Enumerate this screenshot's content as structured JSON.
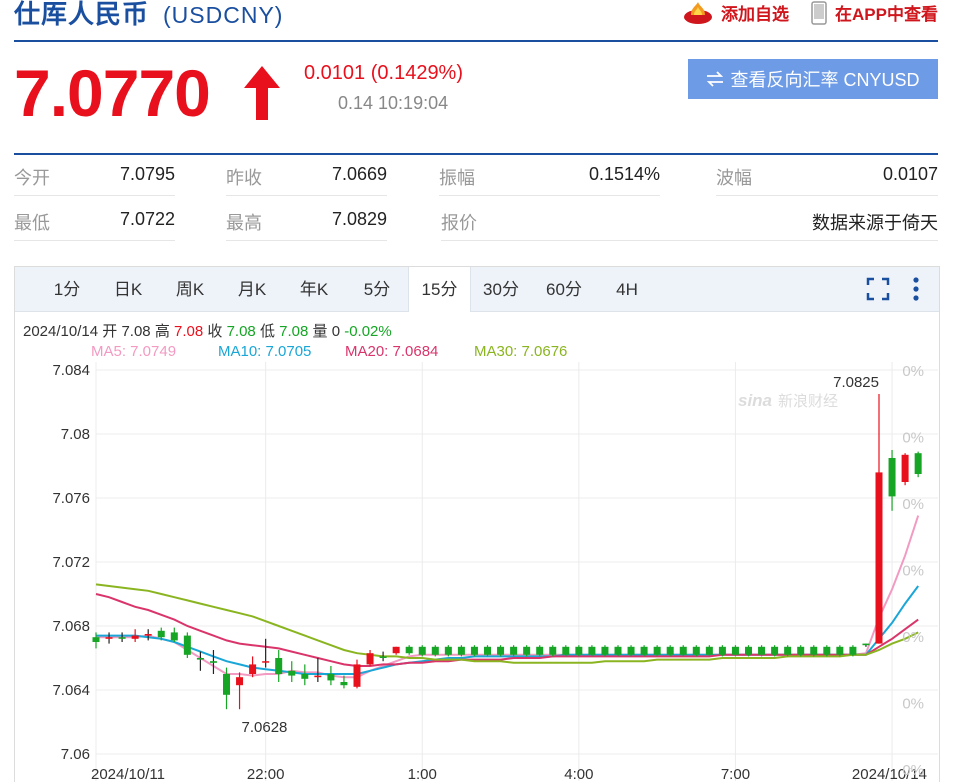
{
  "header": {
    "title": "仕厍人民币",
    "code": "(USDCNY)",
    "add_watch": "添加自选",
    "view_app": "在APP中查看"
  },
  "quote": {
    "price": "7.0770",
    "change": "0.0101 (0.1429%)",
    "time": "0.14 10:19:04",
    "reverse_button": "查看反向汇率 CNYUSD"
  },
  "stats": [
    {
      "label": "今开",
      "value": "7.0795"
    },
    {
      "label": "昨收",
      "value": "7.0669"
    },
    {
      "label": "振幅",
      "value": "0.1514%"
    },
    {
      "label": "波幅",
      "value": "0.0107"
    },
    {
      "label": "最低",
      "value": "7.0722"
    },
    {
      "label": "最高",
      "value": "7.0829"
    },
    {
      "label": "报价",
      "value": ""
    },
    {
      "label": "",
      "value": "数据来源于倚天"
    }
  ],
  "tabs": [
    "1分",
    "日K",
    "周K",
    "月K",
    "年K",
    "5分",
    "15分",
    "30分",
    "60分",
    "4H"
  ],
  "active_tab": "15分",
  "ohlc": {
    "date": "2024/10/14",
    "open_label": "开",
    "open": "7.08",
    "high_label": "高",
    "high": "7.08",
    "close_label": "收",
    "close": "7.08",
    "low_label": "低",
    "low": "7.08",
    "volume_label": "量",
    "volume": "0",
    "pct": "-0.02%"
  },
  "ma_legend": [
    {
      "text": "MA5: 7.0749",
      "color": "#f29ac2"
    },
    {
      "text": "MA10: 7.0705",
      "color": "#1aa6d6"
    },
    {
      "text": "MA20: 7.0684",
      "color": "#d9356b"
    },
    {
      "text": "MA30: 7.0676",
      "color": "#8ab520"
    }
  ],
  "colors": {
    "up": "#e8101c",
    "down": "#16a525",
    "accent": "#1a4fa0",
    "button": "#6e9be6"
  },
  "icons": [
    "flame-icon",
    "phone-icon",
    "up-arrow-icon",
    "swap-icon",
    "fullscreen-icon",
    "more-vertical-icon"
  ],
  "chart_data": {
    "type": "candlestick",
    "y_ticks": [
      "7.084",
      "7.08",
      "7.076",
      "7.072",
      "7.068",
      "7.064",
      "7.06"
    ],
    "ylim": [
      7.06,
      7.0845
    ],
    "x_ticks": [
      {
        "label": "2024/10/11",
        "index": 0
      },
      {
        "label": "22:00",
        "index": 13
      },
      {
        "label": "1:00",
        "index": 25
      },
      {
        "label": "4:00",
        "index": 37
      },
      {
        "label": "7:00",
        "index": 49
      },
      {
        "label": "2024/10/14",
        "index": 61
      }
    ],
    "right_pct_labels": [
      "0%",
      "0%",
      "0%",
      "0%",
      "0%",
      "0%",
      "0%"
    ],
    "annotations": [
      {
        "text": "7.0825",
        "index": 60,
        "value": 7.0825,
        "position": "above"
      },
      {
        "text": "7.0628",
        "index": 10,
        "value": 7.0628,
        "position": "below"
      }
    ],
    "candles": [
      [
        7.0673,
        7.067,
        7.0676,
        7.0666
      ],
      [
        7.0672,
        7.0673,
        7.0676,
        7.0669
      ],
      [
        7.0673,
        7.0672,
        7.0676,
        7.067
      ],
      [
        7.0672,
        7.0674,
        7.0678,
        7.067
      ],
      [
        7.0674,
        7.0675,
        7.0678,
        7.0671
      ],
      [
        7.0677,
        7.0673,
        7.0679,
        7.0671
      ],
      [
        7.0676,
        7.0671,
        7.0679,
        7.067
      ],
      [
        7.0674,
        7.0662,
        7.0676,
        7.066
      ],
      [
        7.066,
        7.0659,
        7.0664,
        7.0652
      ],
      [
        7.0658,
        7.0657,
        7.0665,
        7.065
      ],
      [
        7.065,
        7.0637,
        7.0654,
        7.0628
      ],
      [
        7.0643,
        7.0648,
        7.0651,
        7.0628
      ],
      [
        7.065,
        7.0656,
        7.0661,
        7.0648
      ],
      [
        7.0658,
        7.0658,
        7.0672,
        7.0654
      ],
      [
        7.066,
        7.065,
        7.0665,
        7.0645
      ],
      [
        7.0652,
        7.0649,
        7.0658,
        7.0645
      ],
      [
        7.065,
        7.0647,
        7.0656,
        7.0643
      ],
      [
        7.0648,
        7.0649,
        7.066,
        7.0645
      ],
      [
        7.065,
        7.0646,
        7.0655,
        7.0643
      ],
      [
        7.0645,
        7.0643,
        7.0649,
        7.0641
      ],
      [
        7.0642,
        7.0656,
        7.0659,
        7.0641
      ],
      [
        7.0656,
        7.0663,
        7.0665,
        7.0655
      ],
      [
        7.0661,
        7.066,
        7.0664,
        7.0658
      ],
      [
        7.0663,
        7.0667,
        7.0667,
        7.0662
      ],
      [
        7.0667,
        7.0663,
        7.0668,
        7.0662
      ],
      [
        7.0667,
        7.0662,
        7.0668,
        7.0661
      ],
      [
        7.0667,
        7.0662,
        7.0668,
        7.0661
      ],
      [
        7.0667,
        7.0662,
        7.0668,
        7.0661
      ],
      [
        7.0667,
        7.0662,
        7.0668,
        7.0661
      ],
      [
        7.0667,
        7.0662,
        7.0668,
        7.0661
      ],
      [
        7.0667,
        7.0662,
        7.0668,
        7.0661
      ],
      [
        7.0667,
        7.0662,
        7.0668,
        7.0661
      ],
      [
        7.0667,
        7.0662,
        7.0668,
        7.0661
      ],
      [
        7.0667,
        7.0662,
        7.0668,
        7.0661
      ],
      [
        7.0667,
        7.0662,
        7.0668,
        7.0661
      ],
      [
        7.0667,
        7.0662,
        7.0668,
        7.0661
      ],
      [
        7.0667,
        7.0662,
        7.0668,
        7.0661
      ],
      [
        7.0667,
        7.0662,
        7.0668,
        7.0661
      ],
      [
        7.0667,
        7.0662,
        7.0668,
        7.0661
      ],
      [
        7.0667,
        7.0662,
        7.0668,
        7.0661
      ],
      [
        7.0667,
        7.0662,
        7.0668,
        7.0661
      ],
      [
        7.0667,
        7.0662,
        7.0668,
        7.0661
      ],
      [
        7.0667,
        7.0662,
        7.0668,
        7.0661
      ],
      [
        7.0667,
        7.0662,
        7.0668,
        7.0661
      ],
      [
        7.0667,
        7.0662,
        7.0668,
        7.0661
      ],
      [
        7.0667,
        7.0662,
        7.0668,
        7.0661
      ],
      [
        7.0667,
        7.0662,
        7.0668,
        7.0661
      ],
      [
        7.0667,
        7.0662,
        7.0668,
        7.0661
      ],
      [
        7.0667,
        7.0662,
        7.0668,
        7.0661
      ],
      [
        7.0667,
        7.0662,
        7.0668,
        7.0661
      ],
      [
        7.0667,
        7.0662,
        7.0668,
        7.0661
      ],
      [
        7.0667,
        7.0662,
        7.0668,
        7.0661
      ],
      [
        7.0667,
        7.0662,
        7.0668,
        7.0661
      ],
      [
        7.0667,
        7.0662,
        7.0668,
        7.0661
      ],
      [
        7.0667,
        7.0662,
        7.0668,
        7.0661
      ],
      [
        7.0667,
        7.0662,
        7.0668,
        7.0661
      ],
      [
        7.0667,
        7.0662,
        7.0668,
        7.0661
      ],
      [
        7.0667,
        7.0662,
        7.0668,
        7.0661
      ],
      [
        7.0667,
        7.0662,
        7.0668,
        7.0661
      ],
      [
        7.0669,
        7.0668,
        7.0669,
        7.0667
      ],
      [
        7.0669,
        7.0776,
        7.0825,
        7.0669
      ],
      [
        7.0785,
        7.0761,
        7.079,
        7.0752
      ],
      [
        7.077,
        7.0787,
        7.0788,
        7.0768
      ],
      [
        7.0788,
        7.0775,
        7.0789,
        7.0773
      ]
    ],
    "ma": {
      "MA5": [
        7.0673,
        7.0673,
        7.0673,
        7.0673,
        7.0674,
        7.0672,
        7.067,
        7.0665,
        7.066,
        7.0655,
        7.065,
        7.065,
        7.0649,
        7.065,
        7.065,
        7.0652,
        7.0651,
        7.0651,
        7.0649,
        7.0648,
        7.0648,
        7.0652,
        7.0655,
        7.0658,
        7.0661,
        7.0662,
        7.0662,
        7.0662,
        7.0662,
        7.0662,
        7.0662,
        7.0662,
        7.0662,
        7.0662,
        7.0662,
        7.0662,
        7.0662,
        7.0662,
        7.0662,
        7.0662,
        7.0662,
        7.0662,
        7.0662,
        7.0662,
        7.0662,
        7.0662,
        7.0662,
        7.0662,
        7.0662,
        7.0662,
        7.0662,
        7.0662,
        7.0662,
        7.0662,
        7.0662,
        7.0662,
        7.0662,
        7.0662,
        7.0662,
        7.0663,
        7.0685,
        7.0703,
        7.0724,
        7.0749
      ],
      "MA10": [
        7.0674,
        7.0674,
        7.0674,
        7.0674,
        7.0673,
        7.0672,
        7.067,
        7.0667,
        7.0664,
        7.0661,
        7.0658,
        7.0656,
        7.0654,
        7.0653,
        7.0652,
        7.0651,
        7.065,
        7.065,
        7.065,
        7.065,
        7.065,
        7.0652,
        7.0654,
        7.0656,
        7.0657,
        7.0658,
        7.0659,
        7.066,
        7.066,
        7.0661,
        7.0661,
        7.0661,
        7.0661,
        7.0661,
        7.0661,
        7.0661,
        7.0662,
        7.0662,
        7.0662,
        7.0662,
        7.0662,
        7.0662,
        7.0662,
        7.0662,
        7.0662,
        7.0662,
        7.0662,
        7.0662,
        7.0662,
        7.0662,
        7.0662,
        7.0662,
        7.0662,
        7.0662,
        7.0662,
        7.0662,
        7.0662,
        7.0662,
        7.0662,
        7.0662,
        7.0672,
        7.0682,
        7.0694,
        7.0705
      ],
      "MA20": [
        7.07,
        7.0698,
        7.0695,
        7.0692,
        7.069,
        7.0687,
        7.0684,
        7.068,
        7.0677,
        7.0674,
        7.0671,
        7.0669,
        7.0668,
        7.0667,
        7.0666,
        7.0664,
        7.0662,
        7.066,
        7.0658,
        7.0656,
        7.0655,
        7.0655,
        7.0656,
        7.0656,
        7.0657,
        7.0657,
        7.0658,
        7.0658,
        7.0659,
        7.0659,
        7.0659,
        7.0659,
        7.066,
        7.066,
        7.066,
        7.0661,
        7.0661,
        7.0661,
        7.0661,
        7.0661,
        7.0661,
        7.0661,
        7.0661,
        7.0661,
        7.0661,
        7.0661,
        7.0661,
        7.0661,
        7.0662,
        7.0662,
        7.0662,
        7.0662,
        7.0662,
        7.0662,
        7.0662,
        7.0662,
        7.0662,
        7.0662,
        7.0662,
        7.0662,
        7.0667,
        7.0672,
        7.0678,
        7.0684
      ],
      "MA30": [
        7.0706,
        7.0705,
        7.0704,
        7.0703,
        7.0702,
        7.07,
        7.0698,
        7.0696,
        7.0694,
        7.0692,
        7.069,
        7.0688,
        7.0686,
        7.0683,
        7.068,
        7.0677,
        7.0674,
        7.0671,
        7.0668,
        7.0665,
        7.0663,
        7.0662,
        7.0661,
        7.0661,
        7.066,
        7.066,
        7.0659,
        7.0659,
        7.0659,
        7.0658,
        7.0658,
        7.0658,
        7.0657,
        7.0657,
        7.0657,
        7.0657,
        7.0657,
        7.0657,
        7.0657,
        7.0658,
        7.0658,
        7.0658,
        7.0658,
        7.0659,
        7.0659,
        7.0659,
        7.0659,
        7.0659,
        7.066,
        7.066,
        7.066,
        7.066,
        7.066,
        7.0661,
        7.0661,
        7.0661,
        7.0661,
        7.0661,
        7.0662,
        7.0662,
        7.0665,
        7.0669,
        7.0672,
        7.0676
      ]
    },
    "grid": true
  }
}
